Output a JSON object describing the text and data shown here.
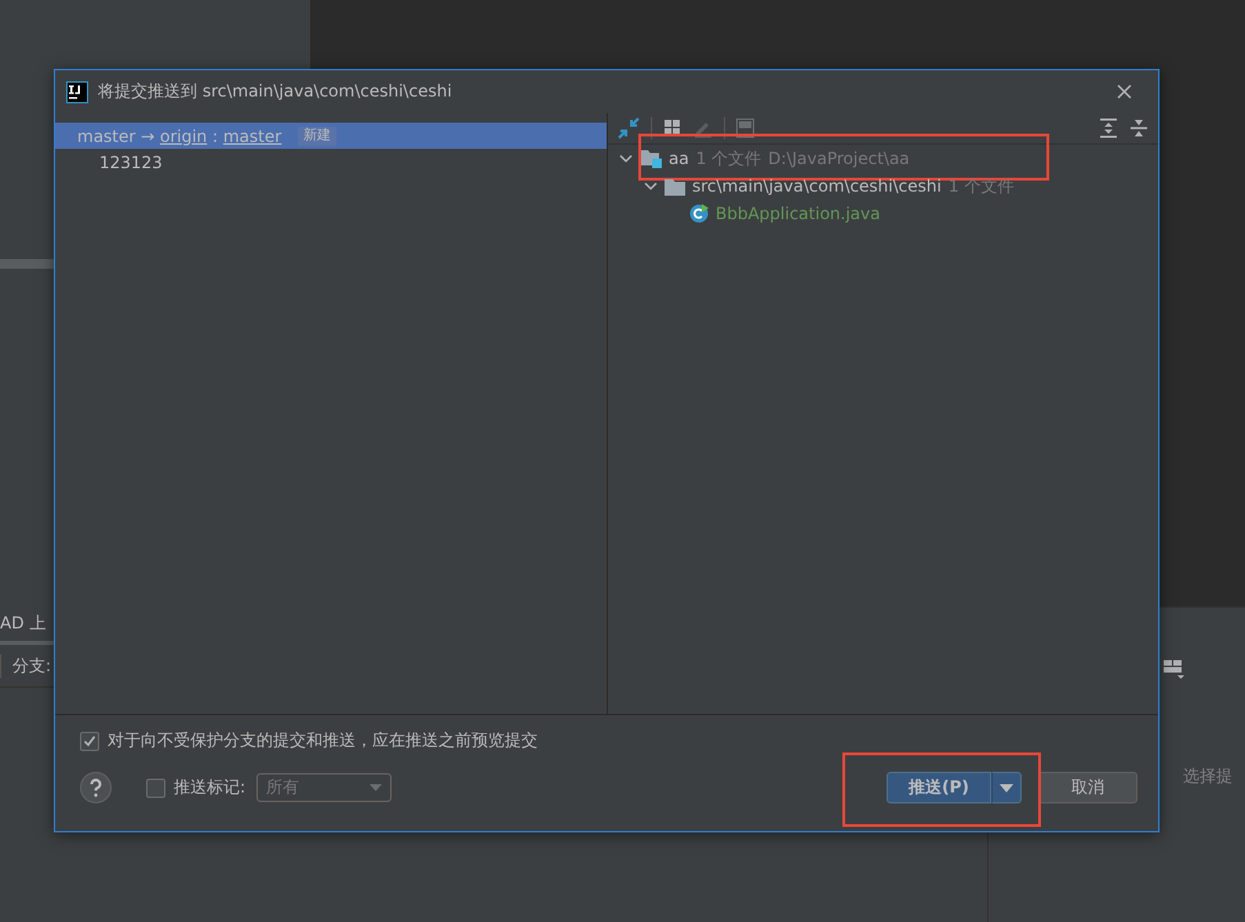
{
  "background": {
    "tab_label": "AD 上",
    "branch_label": "分支:",
    "hint": "选择提"
  },
  "dialog": {
    "title": "将提交推送到 src\\main\\java\\com\\ceshi\\ceshi",
    "commits": [
      {
        "local": "master",
        "arrow": "→",
        "remote": "origin",
        "separator": ":",
        "branch": "master",
        "badge": "新建",
        "selected": true,
        "children": [
          {
            "label": "123123",
            "selected": false
          }
        ]
      }
    ],
    "tree": [
      {
        "kind": "module",
        "name": "aa",
        "count": "1 个文件",
        "path": "D:\\JavaProject\\aa",
        "expanded": true,
        "highlighted": true,
        "children": [
          {
            "kind": "folder",
            "name": "src\\main\\java\\com\\ceshi\\ceshi",
            "count": "1 个文件",
            "expanded": true,
            "highlighted": false,
            "children": [
              {
                "kind": "class",
                "name": "BbbApplication.java",
                "highlighted": false
              }
            ]
          }
        ]
      }
    ],
    "preview_option": {
      "label": "对于向不受保护分支的提交和推送，应在推送之前预览提交",
      "checked": true
    },
    "push_tags": {
      "label": "推送标记:",
      "checked": false,
      "value": "所有"
    },
    "push_button": {
      "label": "推送(P)",
      "highlighted": true
    },
    "cancel_button": {
      "label": "取消"
    }
  }
}
